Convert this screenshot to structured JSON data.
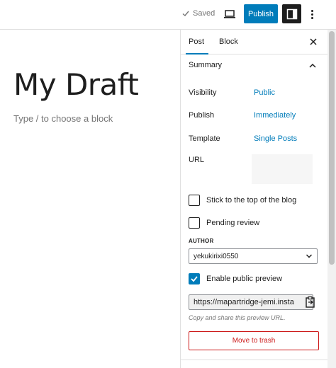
{
  "header": {
    "saved_label": "Saved",
    "publish_label": "Publish"
  },
  "editor": {
    "title": "My Draft",
    "placeholder": "Type / to choose a block"
  },
  "sidebar": {
    "tabs": [
      {
        "label": "Post",
        "active": true
      },
      {
        "label": "Block",
        "active": false
      }
    ],
    "summary": {
      "title": "Summary",
      "rows": [
        {
          "label": "Visibility",
          "value": "Public"
        },
        {
          "label": "Publish",
          "value": "Immediately"
        },
        {
          "label": "Template",
          "value": "Single Posts"
        },
        {
          "label": "URL",
          "value": ""
        }
      ]
    },
    "checkboxes": [
      {
        "label": "Stick to the top of the blog",
        "checked": false
      },
      {
        "label": "Pending review",
        "checked": false
      }
    ],
    "author": {
      "label": "AUTHOR",
      "selected": "yekukirixi0550"
    },
    "public_preview": {
      "label": "Enable public preview",
      "checked": true,
      "url": "https://mapartridge-jemi.insta",
      "help": "Copy and share this preview URL."
    },
    "trash_label": "Move to trash"
  },
  "colors": {
    "accent": "#007cba",
    "danger": "#cc1818"
  },
  "icons": [
    "check-icon",
    "desktop-preview-icon",
    "sidebar-toggle-icon",
    "more-vertical-icon",
    "close-icon",
    "chevron-up-icon",
    "chevron-down-icon",
    "clipboard-copy-icon"
  ]
}
